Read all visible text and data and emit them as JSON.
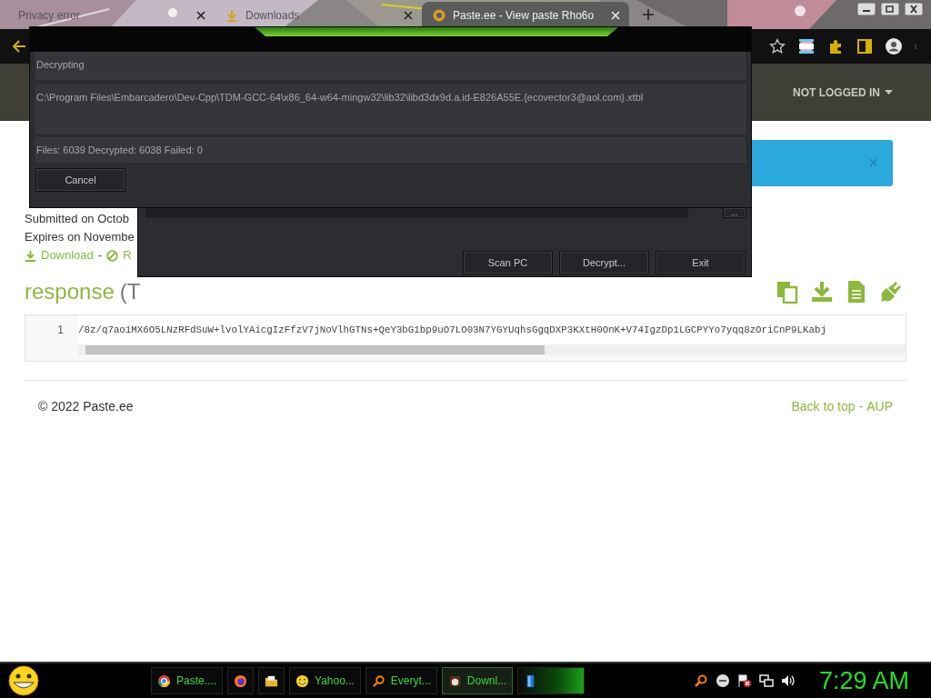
{
  "browser": {
    "tabs": [
      {
        "title": "Privacy error",
        "kind": "plain",
        "selected": false
      },
      {
        "title": "Downloads",
        "kind": "download",
        "selected": false
      },
      {
        "title": "Paste.ee - View paste Rho6o",
        "kind": "site",
        "selected": true
      }
    ]
  },
  "page": {
    "nav_user": "NOT LOGGED IN",
    "alert_close": "×",
    "submitted": "Submitted on Octob",
    "expires": "Expires on Novembe",
    "actions": [
      {
        "label": "Download",
        "kind": "download"
      },
      {
        "label": "R",
        "kind": "ban"
      }
    ],
    "action_separator": "-",
    "heading": "response",
    "heading_type": "(T",
    "code": {
      "line": "1",
      "text": "/8z/q7ao1MX6O5LNzRFdSuW+lvolYAicgIzFfzV7jNoVlhGTNs+QeY3bG1bp9uO7LO03N7YGYUqhsGgqDXP3KXtH0OnK+V74IgzDp1LGCPYYo7yqq8zOriCnP9LKabj"
    },
    "footer": {
      "copyright": "© 2022 Paste.ee",
      "links": [
        "Back to top",
        "AUP"
      ],
      "separator": "-"
    }
  },
  "decrypt_dialog": {
    "status_label": "Decrypting",
    "current_file": "C:\\Program Files\\Embarcadero\\Dev-Cpp\\TDM-GCC-64\\x86_64-w64-mingw32\\lib32\\libd3dx9d.a.id-E826A55E.{ecovector3@aol.com}.xtbl",
    "counts": "Files: 6039 Decrypted: 6038 Failed: 0",
    "cancel": "Cancel"
  },
  "main_window": {
    "browse": "...",
    "buttons": [
      "Scan PC",
      "Decrypt...",
      "Exit"
    ]
  },
  "taskbar": {
    "tasks": [
      {
        "label": "Paste....",
        "kind": "chrome",
        "selected": false
      },
      {
        "kind": "firefox",
        "selected": false
      },
      {
        "kind": "folder",
        "selected": false
      },
      {
        "label": "Yahoo...",
        "kind": "smiley",
        "selected": false
      },
      {
        "label": "Everyt...",
        "kind": "search",
        "selected": false
      },
      {
        "label": "Downl...",
        "kind": "app",
        "selected": true
      },
      {
        "kind": "device",
        "selected": false
      }
    ],
    "clock": "7:29 AM"
  }
}
